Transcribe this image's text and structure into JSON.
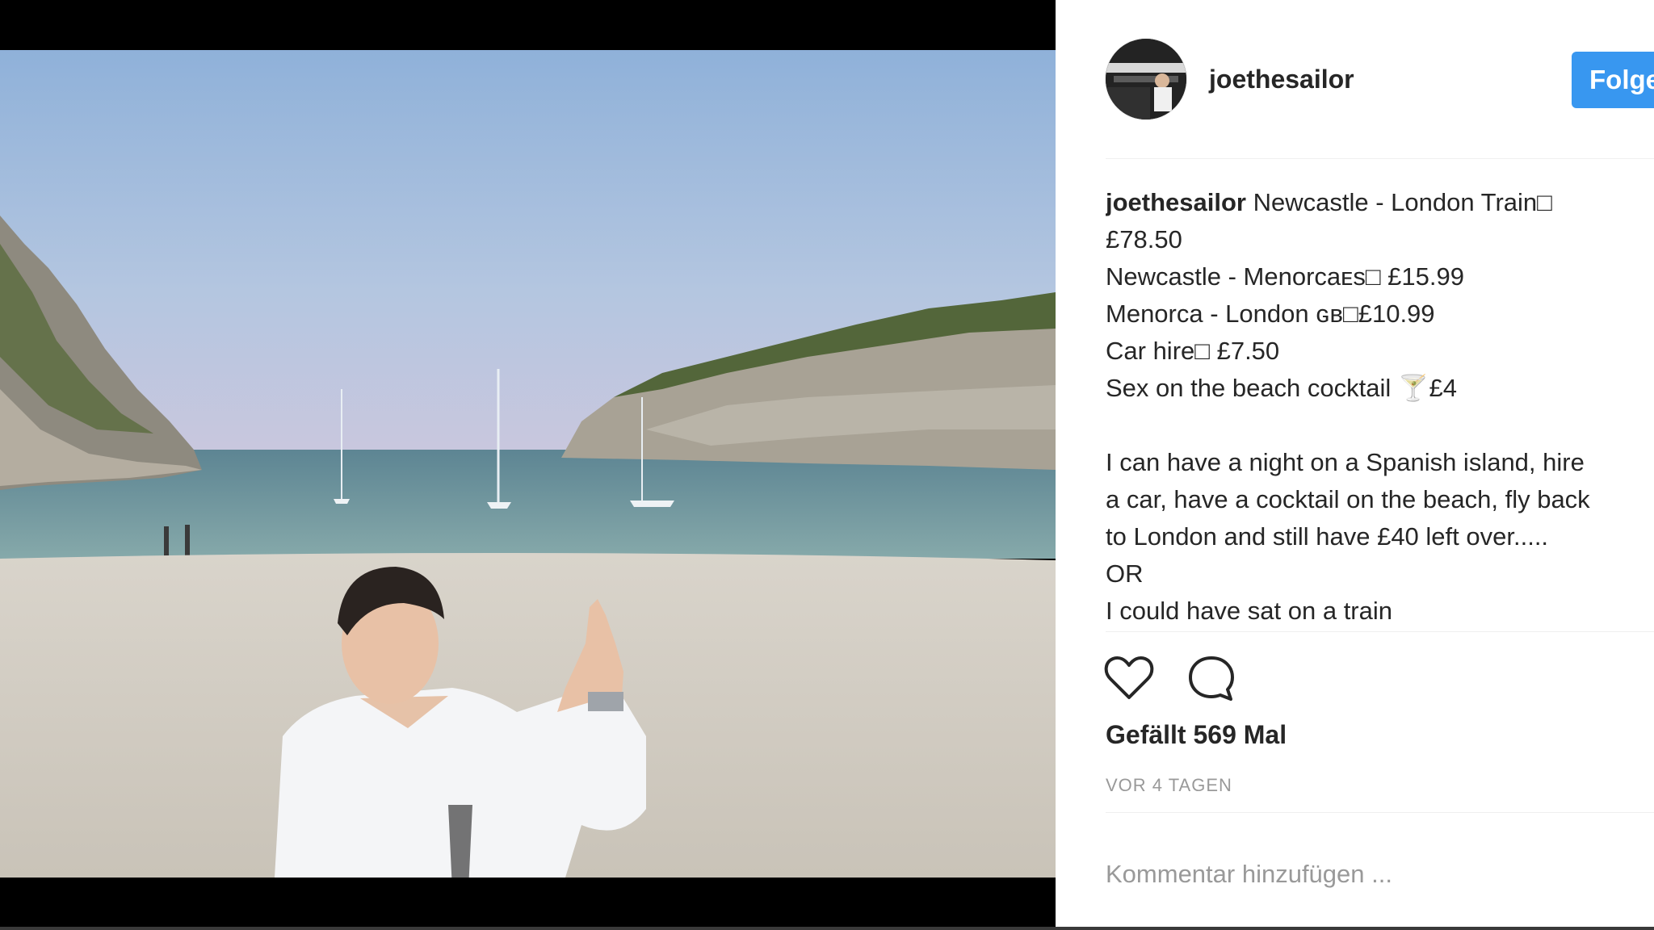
{
  "post": {
    "username": "joethesailor",
    "follow_label": "Folge",
    "caption": {
      "user": "joethesailor",
      "line1": " Newcastle - London Train□",
      "line2": "£78.50",
      "line3": "Newcastle - Menorcaᴇѕ□  £15.99",
      "line4": "Menorca - London ɢʙ□£10.99",
      "line5": "Car hire□  £7.50",
      "line6": "Sex on the beach cocktail 🍸£4",
      "line7": "I can have a night on a Spanish island, hire",
      "line8": "a car, have a cocktail on the beach, fly back",
      "line9": "to London and still have £40 left over.....",
      "line10": "OR",
      "line11": "I could have sat on a train"
    },
    "likes_text": "Gefällt 569 Mal",
    "timestamp": "VOR 4 TAGEN",
    "comment_placeholder": "Kommentar hinzufügen ..."
  },
  "icons": {
    "like": "heart-icon",
    "comment": "comment-bubble-icon"
  },
  "colors": {
    "follow_button": "#3897f0",
    "text": "#262626",
    "muted": "#999999"
  }
}
